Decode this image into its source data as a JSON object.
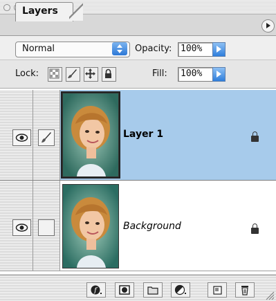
{
  "palette": {
    "tab": "Layers",
    "blend_mode": "Normal",
    "opacity_label": "Opacity:",
    "opacity_value": "100%",
    "lock_label": "Lock:",
    "fill_label": "Fill:",
    "fill_value": "100%"
  },
  "layers": [
    {
      "name": "Layer 1",
      "visible": true,
      "selected": true,
      "linked_brush": true,
      "locked": true
    },
    {
      "name": "Background",
      "visible": true,
      "selected": false,
      "locked": true
    }
  ],
  "footer_buttons": [
    "layer-style",
    "layer-mask",
    "new-set",
    "adjustment-layer",
    "new-layer",
    "delete-layer"
  ],
  "colors": {
    "selection": "#a7cbeb",
    "accent": "#2d78d6"
  }
}
